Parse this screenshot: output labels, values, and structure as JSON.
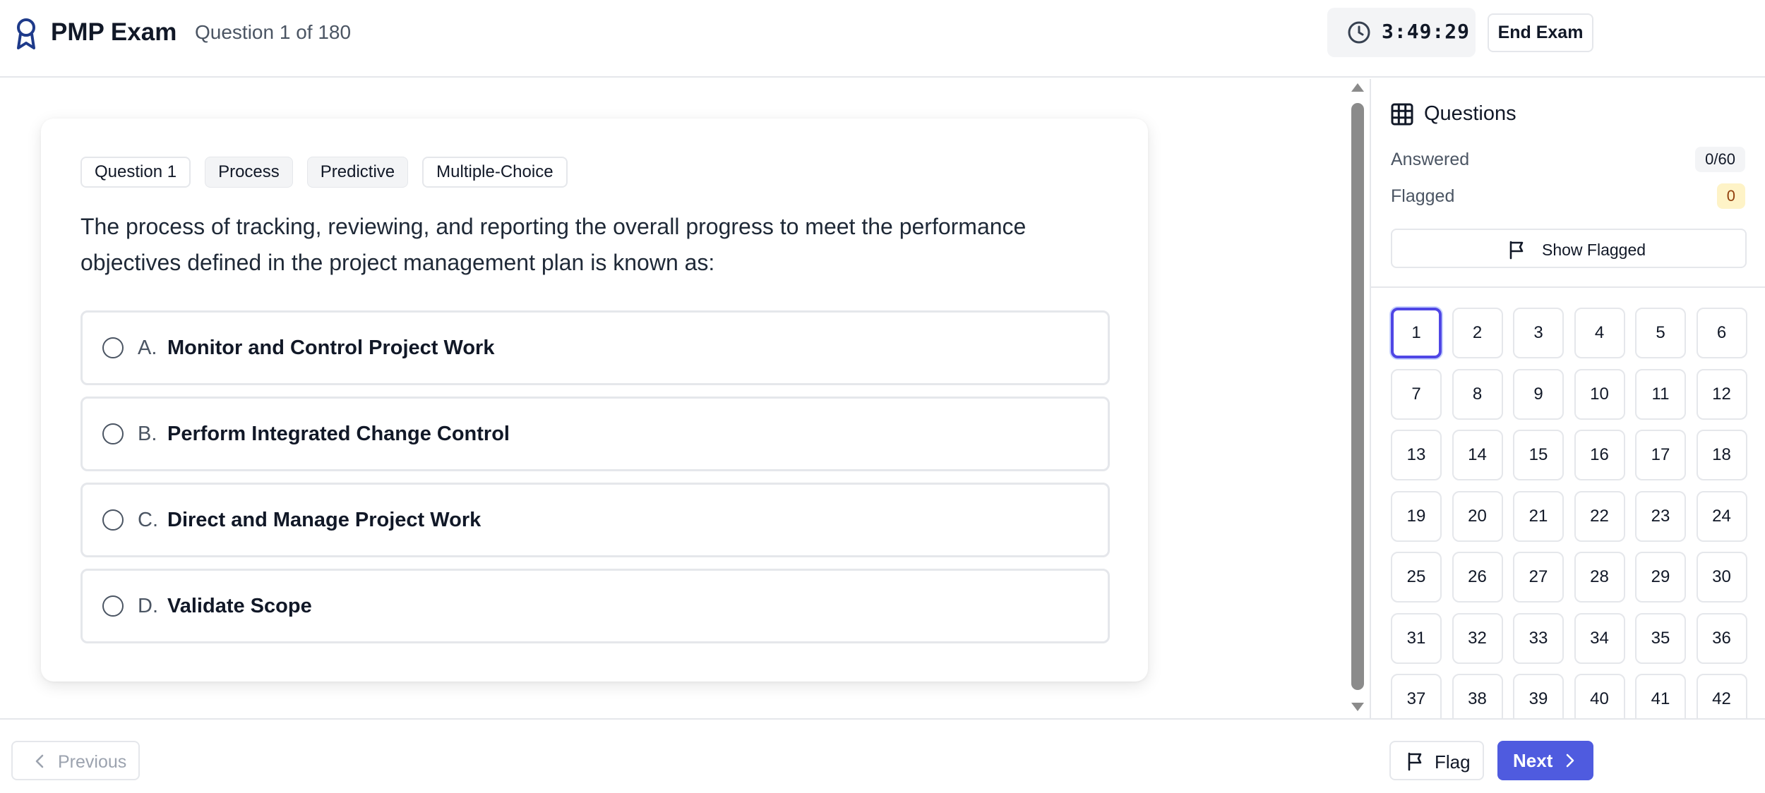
{
  "header": {
    "app_title": "PMP Exam",
    "progress": "Question 1 of 180",
    "timer": "3:49:29",
    "end_exam_label": "End Exam"
  },
  "question": {
    "tags": [
      "Question 1",
      "Process",
      "Predictive",
      "Multiple-Choice"
    ],
    "text": "The process of tracking, reviewing, and reporting the overall progress to meet the performance objectives defined in the project management plan is known as:",
    "options": [
      {
        "letter": "A.",
        "text": "Monitor and Control Project Work"
      },
      {
        "letter": "B.",
        "text": "Perform Integrated Change Control"
      },
      {
        "letter": "C.",
        "text": "Direct and Manage Project Work"
      },
      {
        "letter": "D.",
        "text": "Validate Scope"
      }
    ]
  },
  "panel": {
    "title": "Questions",
    "answered_label": "Answered",
    "answered_value": "0/60",
    "flagged_label": "Flagged",
    "flagged_value": "0",
    "show_flagged_label": "Show Flagged",
    "current_question": "1",
    "question_numbers": [
      "1",
      "2",
      "3",
      "4",
      "5",
      "6",
      "7",
      "8",
      "9",
      "10",
      "11",
      "12",
      "13",
      "14",
      "15",
      "16",
      "17",
      "18",
      "19",
      "20",
      "21",
      "22",
      "23",
      "24",
      "25",
      "26",
      "27",
      "28",
      "29",
      "30",
      "31",
      "32",
      "33",
      "34",
      "35",
      "36",
      "37",
      "38",
      "39",
      "40",
      "41",
      "42"
    ]
  },
  "footer": {
    "previous_label": "Previous",
    "flag_label": "Flag",
    "next_label": "Next"
  },
  "colors": {
    "accent": "#4f5bdf",
    "current_outline": "#4f46e5",
    "flagged_badge_bg": "#fef3c7",
    "border": "#e5e7eb"
  },
  "icons": {
    "logo": "award-ribbon-icon",
    "timer": "clock-icon",
    "panel": "grid-icon",
    "flag": "flag-icon",
    "previous": "chevron-left-icon",
    "next": "chevron-right-icon"
  }
}
